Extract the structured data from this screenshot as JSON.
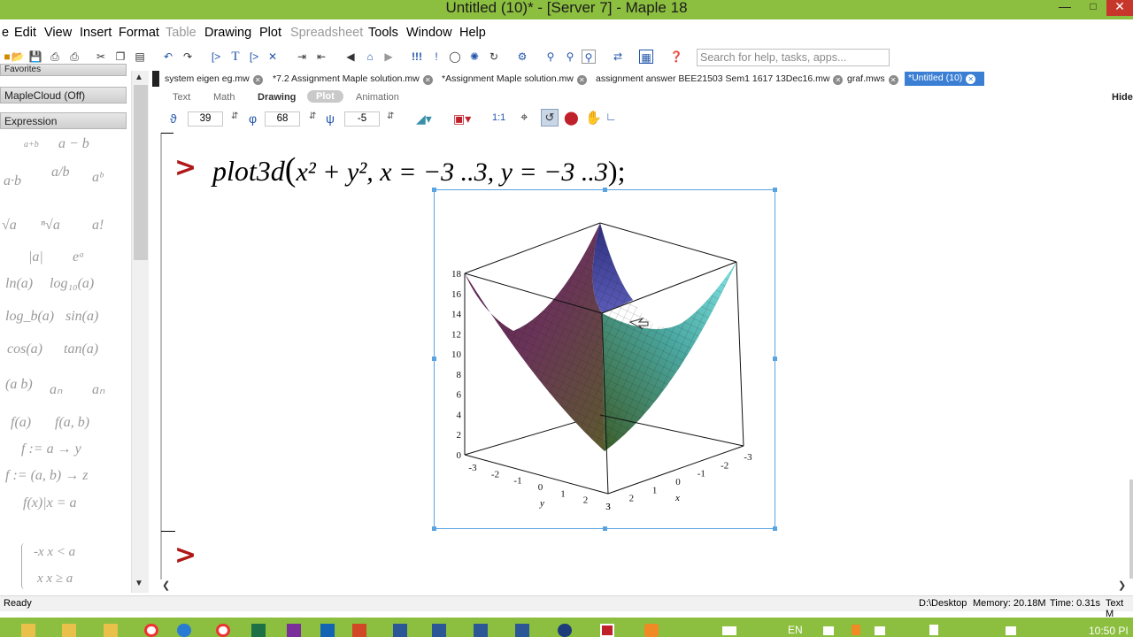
{
  "window": {
    "title": "Untitled (10)* - [Server 7] - Maple 18"
  },
  "menu": [
    "e",
    "Edit",
    "View",
    "Insert",
    "Format",
    "Table",
    "Drawing",
    "Plot",
    "Spreadsheet",
    "Tools",
    "Window",
    "Help"
  ],
  "search": {
    "placeholder": "Search for help, tasks, apps..."
  },
  "left_panel": {
    "favorites": "Favorites",
    "maplecloud": "MapleCloud (Off)",
    "expression": "Expression"
  },
  "palette": [
    "a+b",
    "a − b",
    "a·b",
    "a/b",
    "aᵇ",
    "√a",
    "ⁿ√a",
    "a!",
    "|a|",
    "eᵃ",
    "ln(a)",
    "log₁₀(a)",
    "log_b(a)",
    "sin(a)",
    "cos(a)",
    "tan(a)",
    "(a b)",
    "aₙ",
    "aₙ",
    "f(a)",
    "f(a, b)",
    "f := a → y",
    "f := (a, b) → z",
    "f(x)|x = a",
    "-x  x < a",
    "x  x ≥ a"
  ],
  "tabs": [
    {
      "label": "system eigen eg.mw"
    },
    {
      "label": "*7.2 Assignment Maple solution.mw"
    },
    {
      "label": "*Assignment Maple solution.mw"
    },
    {
      "label": "assignment answer  BEE21503 Sem1 1617 13Dec16.mw"
    },
    {
      "label": "graf.mws"
    },
    {
      "label": "*Untitled (10)"
    }
  ],
  "context_tabs": [
    "Text",
    "Math",
    "Drawing",
    "Plot",
    "Animation"
  ],
  "hide_label": "Hide",
  "plot_toolbar": {
    "theta": "39",
    "phi": "68",
    "psi": "-5",
    "ratio": "1:1"
  },
  "document": {
    "prompt": ">",
    "command_func": "plot3d",
    "command_args": "x² + y², x = −3 ..3, y = −3 ..3",
    "command_end": ");"
  },
  "plot": {
    "z_ticks": [
      "0",
      "2",
      "4",
      "6",
      "8",
      "10",
      "12",
      "14",
      "16",
      "18"
    ],
    "y_ticks": [
      "-3",
      "-2",
      "-1",
      "0",
      "1",
      "2",
      "3"
    ],
    "x_ticks": [
      "3",
      "2",
      "1",
      "0",
      "-1",
      "-2",
      "-3"
    ],
    "y_label": "y",
    "x_label": "x"
  },
  "status": {
    "ready": "Ready",
    "path": "D:\\Desktop",
    "memory": "Memory: 20.18M",
    "time": "Time: 0.31s",
    "mode": "Text M"
  },
  "taskbar": {
    "lang": "EN",
    "clock": "10:50 PI"
  }
}
